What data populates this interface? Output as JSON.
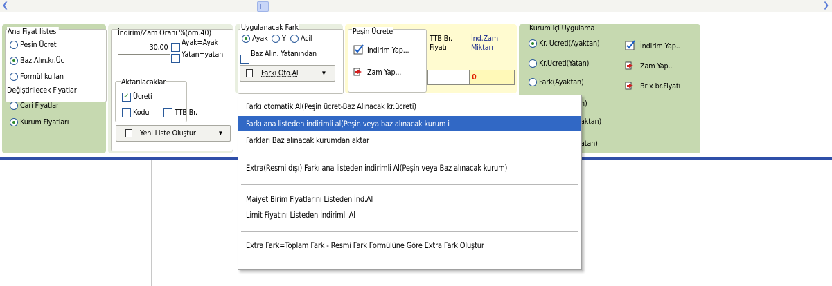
{
  "ana_fiyat": {
    "title": "Ana Fiyat listesi",
    "options": [
      "Peşin Ücret",
      "Baz.Alın.kr.Üc",
      "Formül kullan"
    ],
    "selected": 1
  },
  "degistirilecek": {
    "title": "Değiştirilecek Fiyatlar",
    "options": [
      "Cari Fiyatlar",
      "Kurum Fiyatları"
    ],
    "selected": 1
  },
  "indirim": {
    "label": "İndirim/Zam Oranı %(örn.40)",
    "value": "30,00",
    "ayak_label": "Ayak=Ayak",
    "yatan_label": "Yatan=yatan"
  },
  "aktarilacaklar": {
    "title": "Aktarılacaklar",
    "ucreti": "Ücreti",
    "kodu": "Kodu",
    "ttb": "TTB Br.",
    "ucreti_checked": true
  },
  "yeni_liste_button": "Yeni Liste Oluştur",
  "uygulanacak_fark": {
    "title": "Uygulanacak Fark",
    "options": [
      "Ayak",
      "Y",
      "Acil"
    ],
    "selected": 0,
    "baz_label": "Baz Alın. Yatanından",
    "farki_button": "Farkı Oto.Al"
  },
  "pesin_ucrete": {
    "title": "Peşin Ücrete",
    "indirim_button": "İndirim Yap...",
    "zam_button": "Zam Yap..."
  },
  "ttb": {
    "label_line1": "TTB Br.",
    "label_line2": "Fiyatı"
  },
  "ind_zam": {
    "label_line1": "İnd.Zam",
    "label_line2": "Miktarı",
    "value": "0"
  },
  "kurum_ici": {
    "title": "Kurum içi Uygulama",
    "options": [
      "Kr. Ücreti(Ayaktan)",
      "Kr.Ücreti(Yatan)",
      "Fark(Ayaktan)"
    ],
    "selected": 0,
    "partial": [
      "n)",
      "aktan)",
      "atan)"
    ],
    "indirim_button": "İndirim Yap..",
    "zam_button": "Zam Yap..",
    "brx_button": "Br x br.Fiyatı"
  },
  "menu": {
    "items": [
      "Farkı otomatik Al(Peşin ücret-Baz Alınacak kr.ücreti)",
      "Farkı ana listeden indirimli al(Peşin veya baz alınacak kurum i",
      "Farkları Baz alınacak kurumdan aktar",
      "Extra(Resmi dışı) Farkı ana listeden indirimli Al(Peşin veya Baz alınacak kurum)",
      "Maiyet Birim Fiyatlarını Listeden İnd.Al",
      "Limit Fiyatını Listeden İndirimli Al",
      "Extra Fark=Toplam Fark - Resmi Fark Formülüne Göre Extra Fark Oluştur"
    ],
    "selected": 1
  },
  "colors": {
    "group_bg": "#c6d9b0",
    "highlight": "#3168c5",
    "blue_line": "#2f4fa8",
    "yellow_field": "#fff9b8"
  }
}
